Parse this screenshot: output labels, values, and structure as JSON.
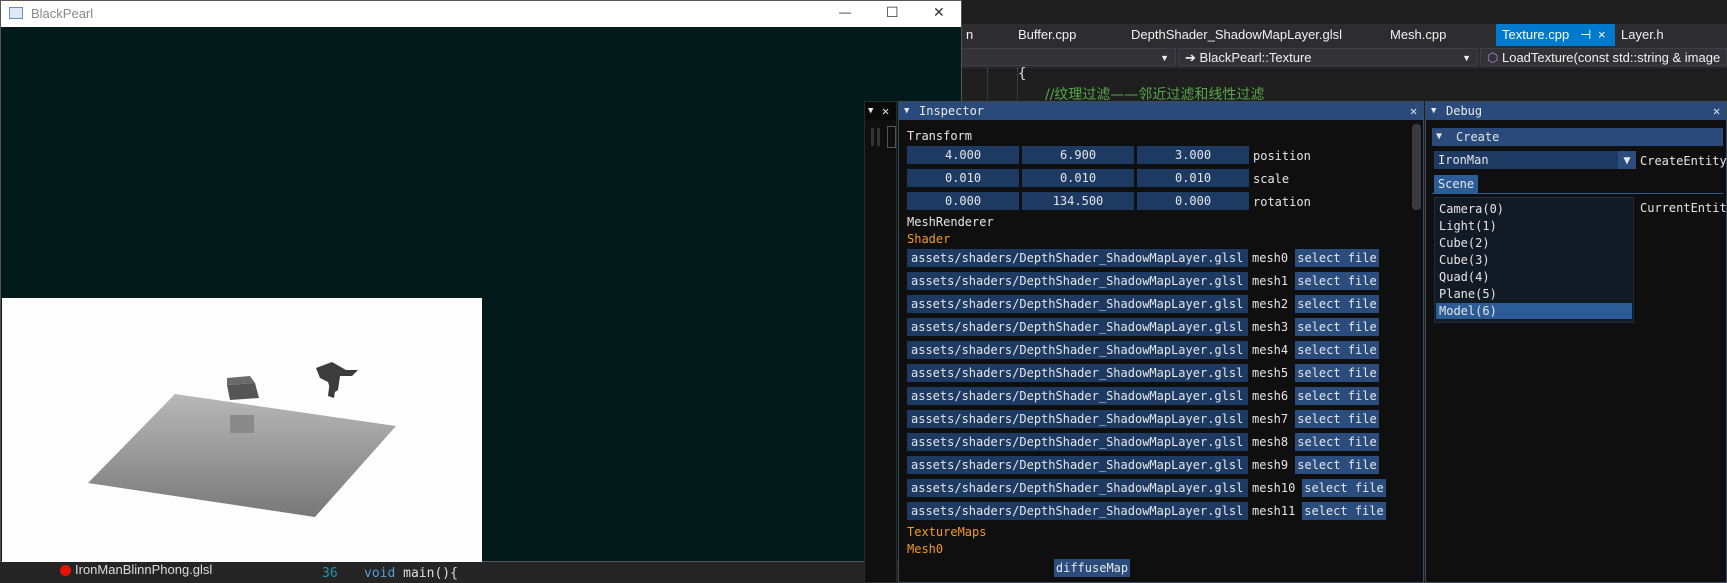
{
  "ide": {
    "tabs": [
      {
        "label": "n",
        "active": false
      },
      {
        "label": "Buffer.cpp",
        "active": false
      },
      {
        "label": "DepthShader_ShadowMapLayer.glsl",
        "active": false
      },
      {
        "label": "Mesh.cpp",
        "active": false
      },
      {
        "label": "Texture.cpp",
        "active": true
      },
      {
        "label": "Layer.h",
        "active": false
      }
    ],
    "pin_glyph": "⊣",
    "tab_close_glyph": "×",
    "nav": {
      "scope": "BlackPearl::Texture",
      "scope_prefix": "➔",
      "member": "LoadTexture(const std::string & image"
    },
    "code": {
      "brace": "{",
      "comment": "//纹理过滤——邻近过滤和线性过滤"
    },
    "bottom": {
      "file": "IronManBlinnPhong.glsl",
      "line_number": "36",
      "keyword": "void",
      "code": " main(){"
    }
  },
  "app": {
    "title": "BlackPearl",
    "controls": {
      "minimize": "—",
      "maximize": "☐",
      "close": "✕"
    }
  },
  "inspector": {
    "title": "Inspector",
    "close_glyph": "✕",
    "transform": {
      "header": "Transform",
      "position": {
        "values": [
          "4.000",
          "6.900",
          "3.000"
        ],
        "label": "position"
      },
      "scale": {
        "values": [
          "0.010",
          "0.010",
          "0.010"
        ],
        "label": "scale"
      },
      "rotation": {
        "values": [
          "0.000",
          "134.500",
          "0.000"
        ],
        "label": "rotation"
      }
    },
    "mesh_renderer": "MeshRenderer",
    "shader_header": "Shader",
    "shaders": [
      {
        "path": "assets/shaders/DepthShader_ShadowMapLayer.glsl",
        "mesh": "mesh0",
        "button": "select file"
      },
      {
        "path": "assets/shaders/DepthShader_ShadowMapLayer.glsl",
        "mesh": "mesh1",
        "button": "select file"
      },
      {
        "path": "assets/shaders/DepthShader_ShadowMapLayer.glsl",
        "mesh": "mesh2",
        "button": "select file"
      },
      {
        "path": "assets/shaders/DepthShader_ShadowMapLayer.glsl",
        "mesh": "mesh3",
        "button": "select file"
      },
      {
        "path": "assets/shaders/DepthShader_ShadowMapLayer.glsl",
        "mesh": "mesh4",
        "button": "select file"
      },
      {
        "path": "assets/shaders/DepthShader_ShadowMapLayer.glsl",
        "mesh": "mesh5",
        "button": "select file"
      },
      {
        "path": "assets/shaders/DepthShader_ShadowMapLayer.glsl",
        "mesh": "mesh6",
        "button": "select file"
      },
      {
        "path": "assets/shaders/DepthShader_ShadowMapLayer.glsl",
        "mesh": "mesh7",
        "button": "select file"
      },
      {
        "path": "assets/shaders/DepthShader_ShadowMapLayer.glsl",
        "mesh": "mesh8",
        "button": "select file"
      },
      {
        "path": "assets/shaders/DepthShader_ShadowMapLayer.glsl",
        "mesh": "mesh9",
        "button": "select file"
      },
      {
        "path": "assets/shaders/DepthShader_ShadowMapLayer.glsl",
        "mesh": "mesh10",
        "button": "select file"
      },
      {
        "path": "assets/shaders/DepthShader_ShadowMapLayer.glsl",
        "mesh": "mesh11",
        "button": "select file"
      }
    ],
    "texture_maps": "TextureMaps",
    "mesh0": "Mesh0",
    "diffuse_button": "diffuseMap"
  },
  "debug": {
    "title": "Debug",
    "close_glyph": "✕",
    "create_header": "Create",
    "create_arrow": "▼",
    "entity_select": "IronMan",
    "create_entity_label": "CreateEntity",
    "scene_tab": "Scene",
    "current_entity_label": "CurrentEntiti",
    "entities": [
      {
        "label": "Camera(0)",
        "selected": false
      },
      {
        "label": "Light(1)",
        "selected": false
      },
      {
        "label": "Cube(2)",
        "selected": false
      },
      {
        "label": "Cube(3)",
        "selected": false
      },
      {
        "label": "Quad(4)",
        "selected": false
      },
      {
        "label": "Plane(5)",
        "selected": false
      },
      {
        "label": "Model(6)",
        "selected": true
      }
    ]
  },
  "colors": {
    "ide_accent": "#007acc",
    "imgui_title": "#294a7a",
    "imgui_frame": "#1d3a63",
    "imgui_button": "#2a4d7e",
    "imgui_header_text": "#ef9b2a",
    "app_background": "#021a1a"
  }
}
